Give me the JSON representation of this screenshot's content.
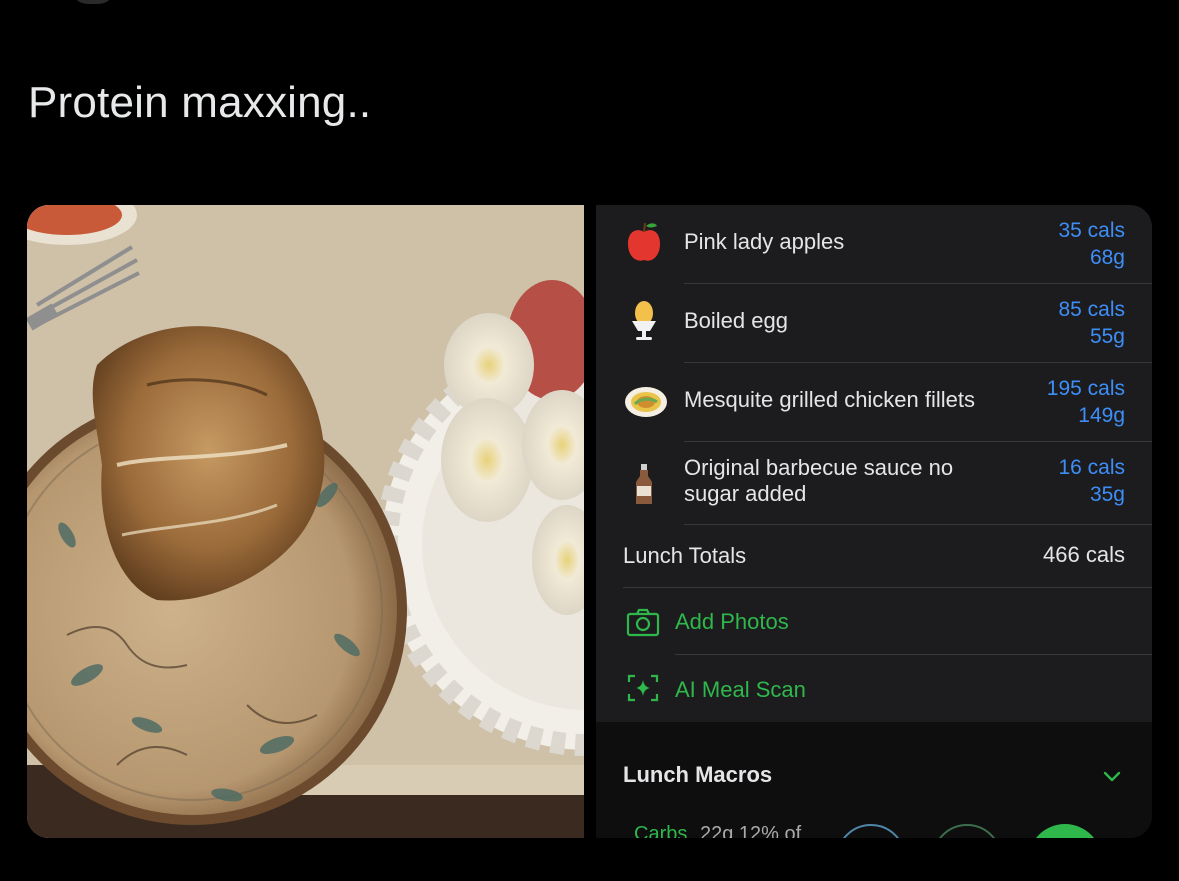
{
  "post": {
    "text": "Protein maxxing.."
  },
  "app": {
    "foods": [
      {
        "name": "Pink lady apples",
        "cals": "35 cals",
        "grams": "68g",
        "icon": "apple-icon"
      },
      {
        "name": "Boiled egg",
        "cals": "85 cals",
        "grams": "55g",
        "icon": "egg-icon"
      },
      {
        "name": "Mesquite grilled chicken fillets",
        "cals": "195 cals",
        "grams": "149g",
        "icon": "food-dish-icon"
      },
      {
        "name": "Original barbecue sauce no sugar added",
        "cals": "16 cals",
        "grams": "35g",
        "icon": "sauce-bottle-icon"
      }
    ],
    "totals": {
      "label": "Lunch Totals",
      "value": "466 cals"
    },
    "actions": {
      "add_photos": "Add Photos",
      "ai_scan": "AI Meal Scan"
    },
    "macros": {
      "title": "Lunch Macros",
      "peek_label": "Carbs",
      "peek_detail": "22g 12% of"
    }
  },
  "colors": {
    "background": "#000000",
    "panel": "#1c1c1e",
    "link_blue": "#3e8ef7",
    "accent_green": "#2fb74b"
  }
}
